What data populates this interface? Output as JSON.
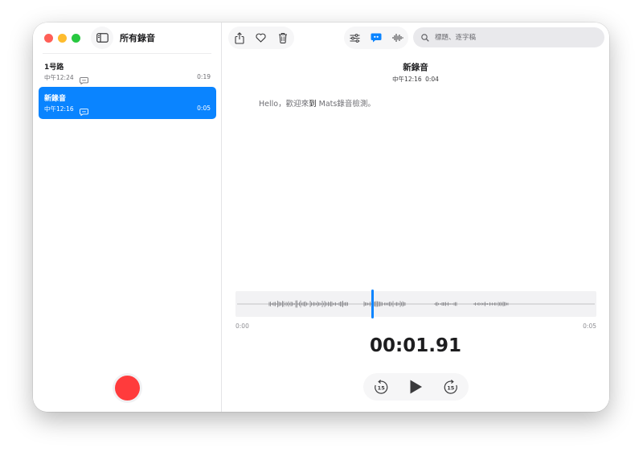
{
  "window": {
    "sidebar_title": "所有錄音"
  },
  "recordings": [
    {
      "name": "1号路",
      "time": "中午12:24",
      "duration": "0:19",
      "selected": false
    },
    {
      "name": "新錄音",
      "time": "中午12:16",
      "duration": "0:05",
      "selected": true
    }
  ],
  "search": {
    "placeholder": "標題、逐字稿",
    "value": ""
  },
  "detail": {
    "title": "新錄音",
    "meta_time": "中午12:16",
    "meta_duration": "0:04",
    "transcript_pre": "Hello，歡迎來",
    "transcript_highlight": "到",
    "transcript_post": " Mats錄音檢測。",
    "timeline_start": "0:00",
    "timeline_end": "0:05",
    "current_time": "00:01.91",
    "playhead_fraction": 0.38
  },
  "controls": {
    "skip_back_seconds": "15",
    "skip_forward_seconds": "15"
  },
  "icons": {
    "sidebar_toggle": "sidebar-icon",
    "share": "share-icon",
    "favorite": "heart-icon",
    "delete": "trash-icon",
    "settings": "sliders-icon",
    "transcript": "quote-bubble-icon",
    "waveform": "waveform-icon",
    "search": "search-icon"
  },
  "colors": {
    "accent": "#0a84ff",
    "record": "#ff3b3c",
    "close": "#ff5f57",
    "minimize": "#febc2e",
    "zoom": "#28c840"
  }
}
